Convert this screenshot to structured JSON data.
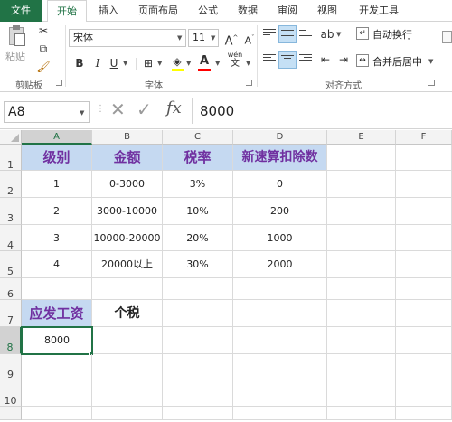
{
  "tabs": [
    "文件",
    "开始",
    "插入",
    "页面布局",
    "公式",
    "数据",
    "审阅",
    "视图",
    "开发工具"
  ],
  "ribbon": {
    "clipboard": {
      "paste_label": "粘贴",
      "group_label": "剪贴板"
    },
    "font": {
      "font_name": "宋体",
      "font_size": "11",
      "grow_label": "A",
      "shrink_label": "A",
      "bold": "B",
      "italic": "I",
      "underline": "U",
      "font_color_label": "A",
      "phonetic_label": "wén",
      "group_label": "字体"
    },
    "alignment": {
      "wrap_label": "自动换行",
      "merge_label": "合并后居中",
      "group_label": "对齐方式"
    }
  },
  "formula_bar": {
    "name_box": "A8",
    "fx_label": "fx",
    "value": "8000"
  },
  "columns": [
    "A",
    "B",
    "C",
    "D",
    "E",
    "F"
  ],
  "rows": [
    "1",
    "2",
    "3",
    "4",
    "5",
    "6",
    "7",
    "8",
    "9",
    "10"
  ],
  "cells": {
    "A1": "级别",
    "B1": "金额",
    "C1": "税率",
    "D1": "新速算扣除数",
    "A2": "1",
    "B2": "0-3000",
    "C2": "3%",
    "D2": "0",
    "A3": "2",
    "B3": "3000-10000",
    "C3": "10%",
    "D3": "200",
    "A4": "3",
    "B4": "10000-20000",
    "C4": "20%",
    "D4": "1000",
    "A5": "4",
    "B5": "20000以上",
    "C5": "30%",
    "D5": "2000",
    "A7": "应发工资",
    "B7": "个税",
    "A8": "8000"
  },
  "selected_cell": "A8",
  "colors": {
    "accent": "#217346",
    "header_fill": "#c5d9f1",
    "header_text": "#7030a0"
  }
}
